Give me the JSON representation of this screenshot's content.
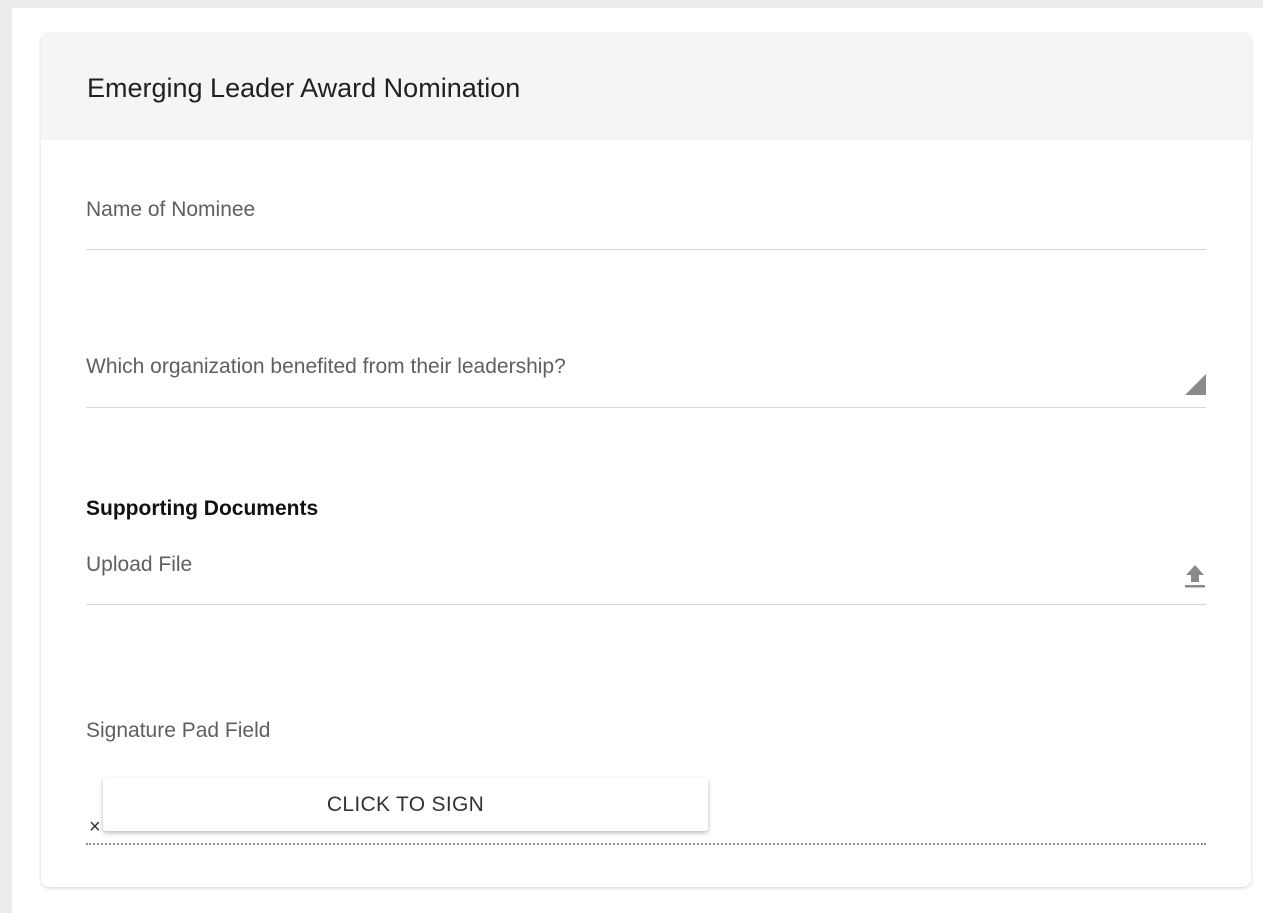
{
  "form": {
    "title": "Emerging Leader Award Nomination",
    "fields": {
      "nominee_label": "Name of Nominee",
      "organization_label": "Which organization benefited from their leadership?"
    },
    "supporting_documents": {
      "title": "Supporting Documents",
      "upload_label": "Upload File"
    },
    "signature": {
      "label": "Signature Pad Field",
      "clear_glyph": "×",
      "sign_button_label": "CLICK TO SIGN"
    }
  },
  "icons": {
    "textarea_resize": "resize-handle-icon",
    "upload": "upload-icon",
    "clear": "close-icon"
  },
  "colors": {
    "header_bg": "#f5f5f5",
    "label_text": "#5f5f5f",
    "title_text": "#212121",
    "icon_gray": "#8a8a8a"
  }
}
